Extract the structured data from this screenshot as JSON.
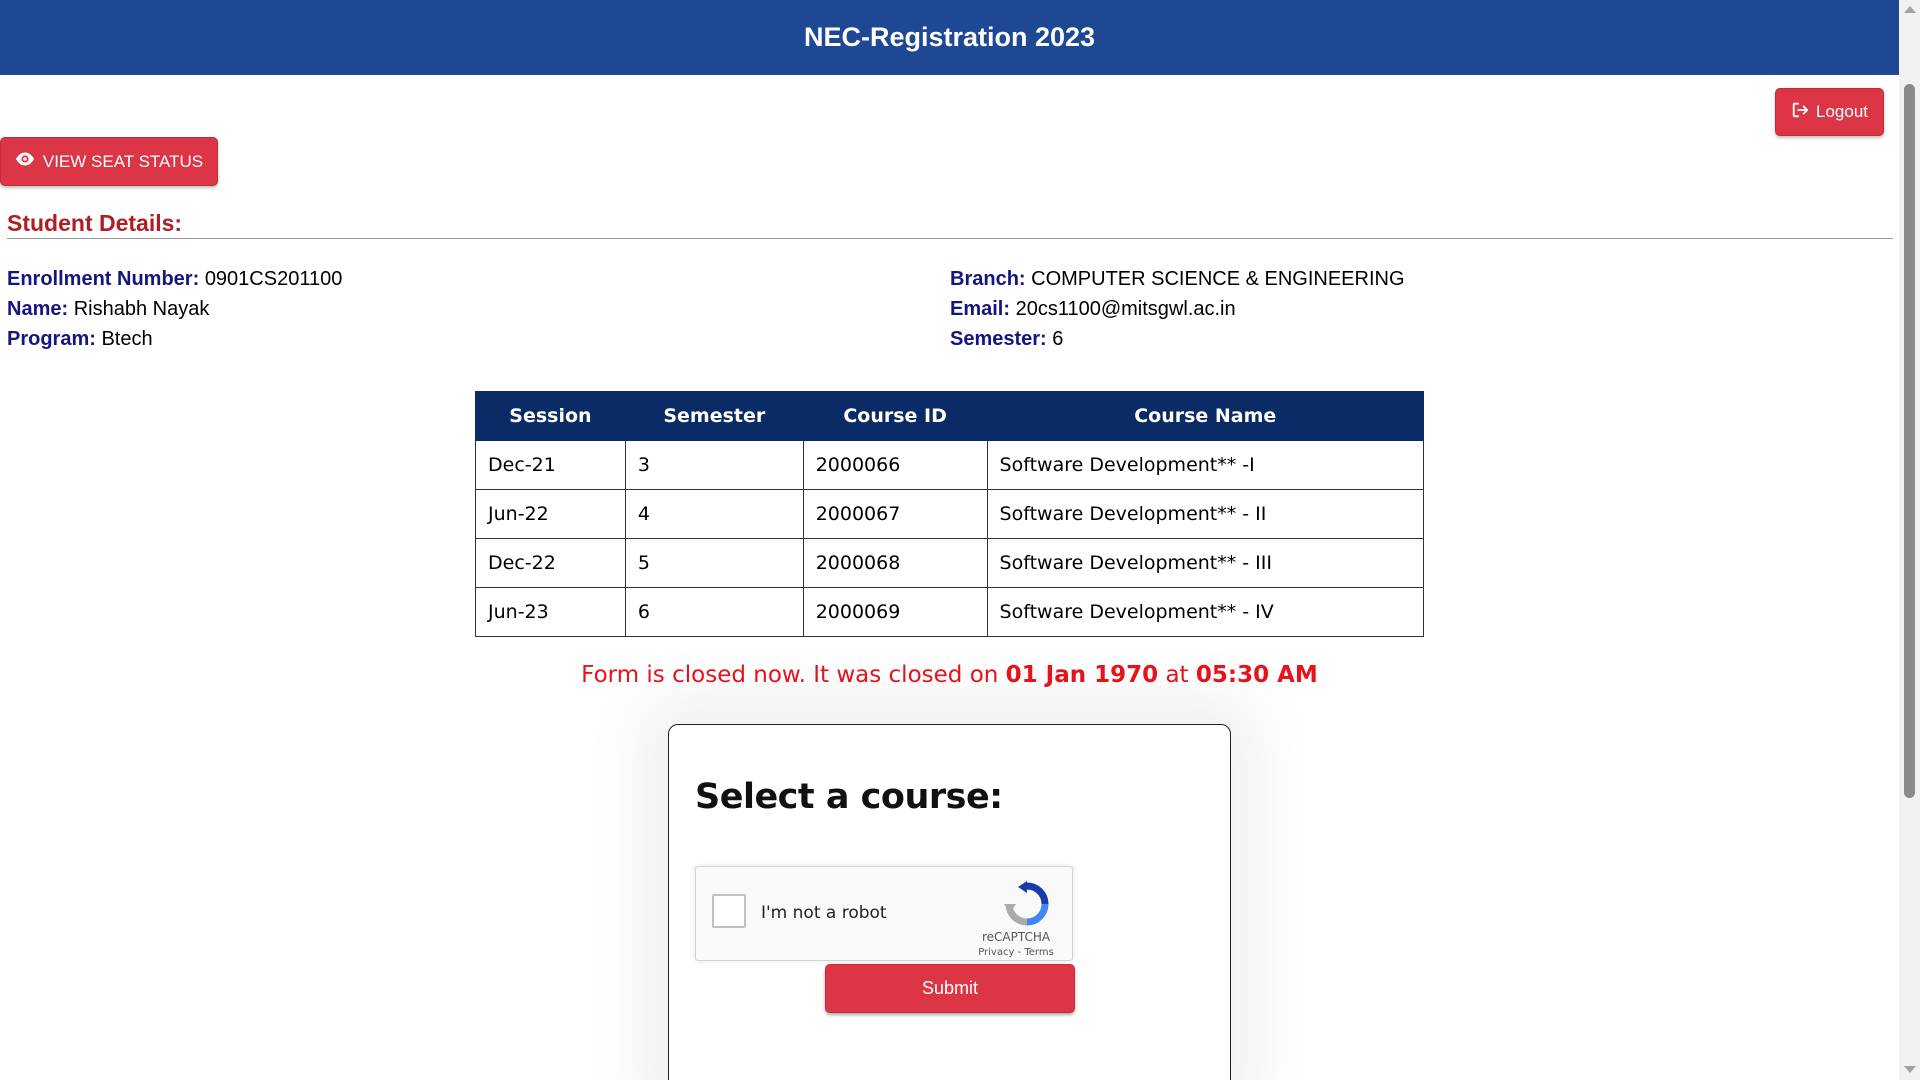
{
  "header": {
    "title": "NEC-Registration 2023"
  },
  "logout": {
    "label": "Logout",
    "icon": "sign-out-icon"
  },
  "seat_status": {
    "label": "VIEW SEAT STATUS",
    "icon": "eye-icon"
  },
  "student": {
    "section_title": "Student Details:",
    "enrollment": {
      "label": "Enrollment Number:",
      "value": "0901CS201100"
    },
    "name": {
      "label": "Name:",
      "value": "Rishabh Nayak"
    },
    "program": {
      "label": "Program:",
      "value": "Btech"
    },
    "branch": {
      "label": "Branch:",
      "value": "COMPUTER SCIENCE & ENGINEERING"
    },
    "email": {
      "label": "Email:",
      "value": "20cs1100@mitsgwl.ac.in"
    },
    "semester": {
      "label": "Semester:",
      "value": "6"
    }
  },
  "table": {
    "headers": [
      "Session",
      "Semester",
      "Course ID",
      "Course Name"
    ],
    "rows": [
      [
        "Dec-21",
        "3",
        "2000066",
        "Software Development** -I"
      ],
      [
        "Jun-22",
        "4",
        "2000067",
        "Software Development** - II"
      ],
      [
        "Dec-22",
        "5",
        "2000068",
        "Software Development** - III"
      ],
      [
        "Jun-23",
        "6",
        "2000069",
        "Software Development** - IV"
      ]
    ]
  },
  "closed": {
    "prefix": "Form is closed now. It was closed on ",
    "date": "01 Jan 1970",
    "middle": " at ",
    "time": "05:30 AM"
  },
  "course_form": {
    "title": "Select a course:",
    "recaptcha": {
      "label": "I'm not a robot",
      "brand": "reCAPTCHA",
      "terms": "Privacy - Terms"
    },
    "submit_label": "Submit"
  },
  "colors": {
    "header_bg": "#1e4794",
    "button_red": "#dc3545",
    "section_title": "#b01e23",
    "label_blue": "#14157f",
    "table_header": "#0a2b66",
    "closed_text": "#e8141c"
  }
}
